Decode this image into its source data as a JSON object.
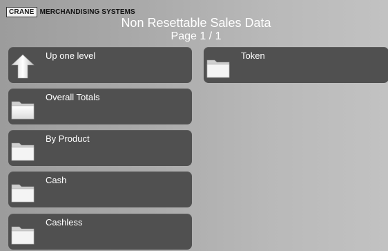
{
  "header": {
    "logo_box": "CRANE",
    "logo_text": "MERCHANDISING SYSTEMS",
    "title": "Non Resettable Sales Data",
    "page": "Page 1 / 1"
  },
  "menu": {
    "up_label": "Up one level",
    "overall_totals": "Overall Totals",
    "by_product": "By Product",
    "cash": "Cash",
    "cashless": "Cashless",
    "token": "Token"
  },
  "icons": {
    "up": "arrow-up-icon",
    "folder": "folder-icon"
  }
}
